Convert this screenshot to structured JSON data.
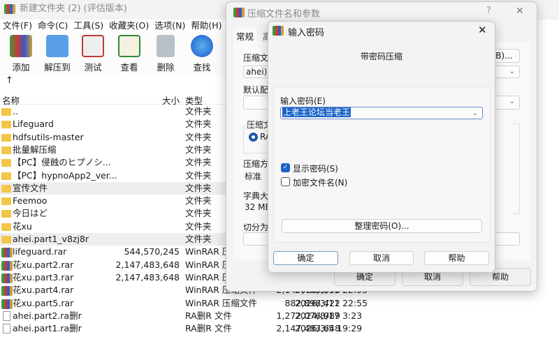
{
  "main": {
    "title": "新建文件夹 (2) (评估版本)",
    "menu": [
      "文件(F)",
      "命令(C)",
      "工具(S)",
      "收藏夹(O)",
      "选项(N)",
      "帮助(H)"
    ],
    "toolbar": [
      "添加",
      "解压到",
      "测试",
      "查看",
      "删除",
      "查找"
    ],
    "up": "↑",
    "columns": {
      "name": "名称",
      "size": "大小",
      "type": "类型"
    },
    "rows": [
      {
        "name": "..",
        "size": "",
        "type": "文件夹",
        "date": "",
        "kind": "folder"
      },
      {
        "name": "Lifeguard",
        "size": "",
        "type": "文件夹",
        "date": "",
        "kind": "folder"
      },
      {
        "name": "hdfsutils-master",
        "size": "",
        "type": "文件夹",
        "date": "",
        "kind": "folder"
      },
      {
        "name": "批量解压缩",
        "size": "",
        "type": "文件夹",
        "date": "",
        "kind": "folder"
      },
      {
        "name": "【PC】侵蝕のヒプノシ...",
        "size": "",
        "type": "文件夹",
        "date": "",
        "kind": "folder"
      },
      {
        "name": "【PC】hypnoApp2_ver...",
        "size": "",
        "type": "文件夹",
        "date": "",
        "kind": "folder"
      },
      {
        "name": "宣传文件",
        "size": "",
        "type": "文件夹",
        "date": "",
        "kind": "folder",
        "sel": true
      },
      {
        "name": "Feemoo",
        "size": "",
        "type": "文件夹",
        "date": "",
        "kind": "folder"
      },
      {
        "name": "今日はど",
        "size": "",
        "type": "文件夹",
        "date": "",
        "kind": "folder"
      },
      {
        "name": "花xu",
        "size": "",
        "type": "文件夹",
        "date": "",
        "kind": "folder"
      },
      {
        "name": "ahei.part1_v8zj8r",
        "size": "",
        "type": "文件夹",
        "date": "",
        "kind": "folder",
        "sel": true
      },
      {
        "name": "lifeguard.rar",
        "size": "544,570,245",
        "type": "WinRAR 压缩文件",
        "date": "",
        "kind": "rar"
      },
      {
        "name": "花xu.part2.rar",
        "size": "2,147,483,648",
        "type": "WinRAR 压缩文件",
        "date": "",
        "kind": "rar"
      },
      {
        "name": "花xu.part3.rar",
        "size": "2,147,483,648",
        "type": "WinRAR 压缩文件",
        "date": "",
        "kind": "rar"
      },
      {
        "name": "花xu.part4.rar",
        "size": "2,147,483,648",
        "type": "WinRAR 压缩文件",
        "date": "2026/3/11 22:55",
        "kind": "rar"
      },
      {
        "name": "花xu.part5.rar",
        "size": "882,898,422",
        "type": "WinRAR 压缩文件",
        "date": "2026/3/11 22:55",
        "kind": "rar"
      },
      {
        "name": "ahei.part2.ra删r",
        "size": "1,272,076,989",
        "type": "RA删R 文件",
        "date": "2024/8/17 3:23",
        "kind": "file"
      },
      {
        "name": "ahei.part1.ra删r",
        "size": "2,147,483,648",
        "type": "RA删R 文件",
        "date": "2026/3/5 19:29",
        "kind": "file"
      }
    ]
  },
  "archive_dialog": {
    "title": "压缩文件名和参数",
    "help": "?",
    "close": "✕",
    "tabs": [
      "常规",
      "高"
    ],
    "archive_name_label": "压缩文件名",
    "archive_name": "ahei).ra",
    "browse": "(B)...",
    "profile_label": "默认配置",
    "format_label": "压缩文件格式",
    "format_rar": "RA",
    "method_label": "压缩方式",
    "method": "标准",
    "dict_label": "字典大小",
    "dict": "32 MB",
    "split_label": "切分为分卷",
    "ok": "确定",
    "cancel": "取消",
    "help_btn": "帮助"
  },
  "password_dialog": {
    "title": "输入密码",
    "close": "✕",
    "subtitle": "带密码压缩",
    "password_label": "输入密码(E)",
    "password": "上老王论坛当老王",
    "show_password": "显示密码(S)",
    "show_password_checked": true,
    "encrypt_names": "加密文件名(N)",
    "encrypt_names_checked": false,
    "organize": "整理密码(O)...",
    "ok": "确定",
    "cancel": "取消",
    "help": "帮助"
  }
}
